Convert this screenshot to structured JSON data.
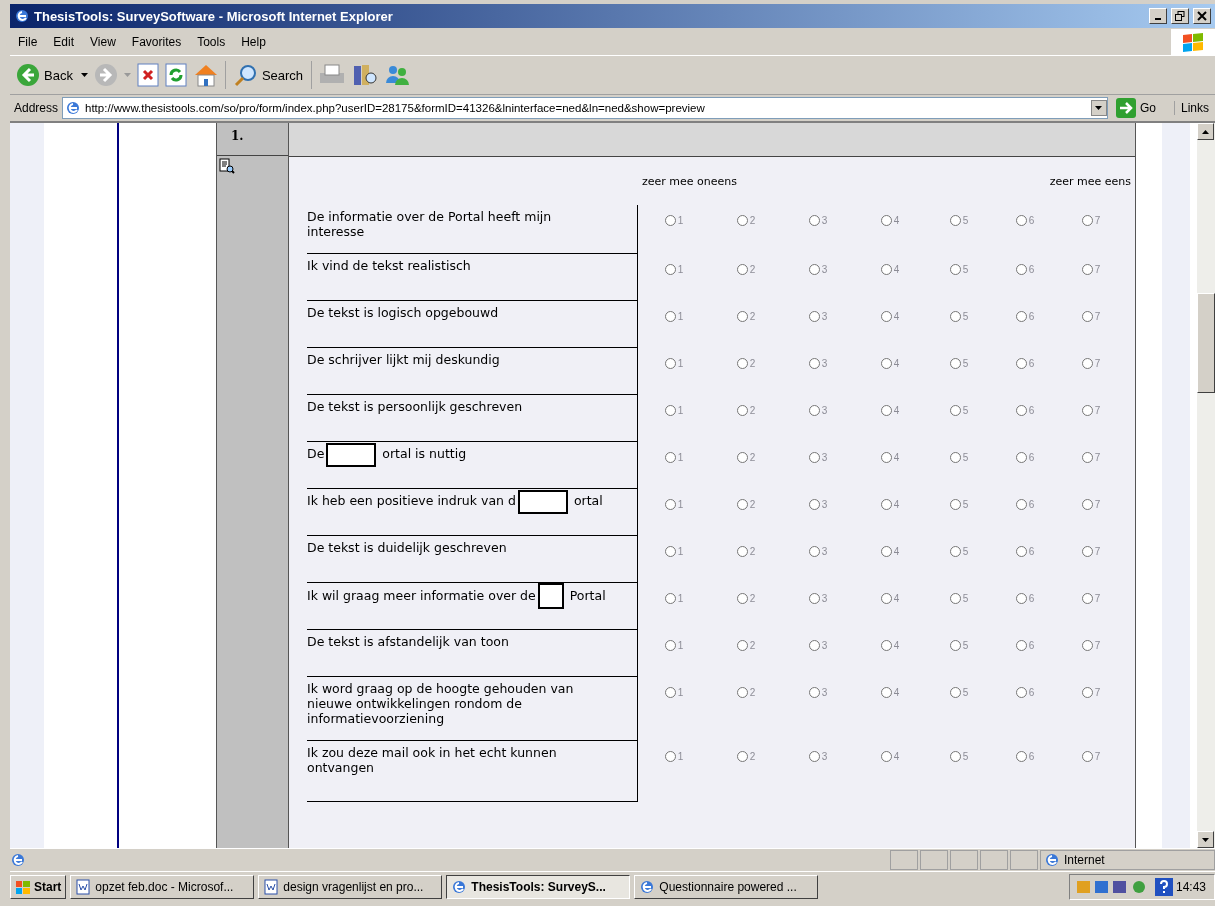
{
  "window": {
    "title": "ThesisTools: SurveySoftware - Microsoft Internet Explorer"
  },
  "menu": [
    "File",
    "Edit",
    "View",
    "Favorites",
    "Tools",
    "Help"
  ],
  "toolbar": {
    "back": "Back",
    "search": "Search"
  },
  "address": {
    "label": "Address",
    "url": "http://www.thesistools.com/so/pro/form/index.php?userID=28175&formID=41326&lninterface=ned&ln=ned&show=preview",
    "go": "Go",
    "links": "Links"
  },
  "question": {
    "number": "1.",
    "scale_low": "zeer mee oneens",
    "scale_high": "zeer mee eens",
    "rows": [
      {
        "parts": [
          "De informatie over de Portal heeft mijn interesse"
        ],
        "choices": [
          {
            "label": "1",
            "selected": false
          },
          {
            "label": "2",
            "selected": false
          },
          {
            "label": "3",
            "selected": false
          },
          {
            "label": "4",
            "selected": false
          },
          {
            "label": "5",
            "selected": false
          },
          {
            "label": "6",
            "selected": false
          },
          {
            "label": "7",
            "selected": false
          }
        ]
      },
      {
        "parts": [
          "Ik vind de tekst realistisch"
        ],
        "choices": [
          {
            "label": "1",
            "selected": false
          },
          {
            "label": "2",
            "selected": false
          },
          {
            "label": "3",
            "selected": false
          },
          {
            "label": "4",
            "selected": false
          },
          {
            "label": "5",
            "selected": false
          },
          {
            "label": "6",
            "selected": false
          },
          {
            "label": "7",
            "selected": false
          }
        ]
      },
      {
        "parts": [
          "De tekst is logisch opgebouwd"
        ],
        "choices": [
          {
            "label": "1",
            "selected": false
          },
          {
            "label": "2",
            "selected": false
          },
          {
            "label": "3",
            "selected": false
          },
          {
            "label": "4",
            "selected": false
          },
          {
            "label": "5",
            "selected": false
          },
          {
            "label": "6",
            "selected": false
          },
          {
            "label": "7",
            "selected": false
          }
        ]
      },
      {
        "parts": [
          "De schrijver lijkt mij deskundig"
        ],
        "choices": [
          {
            "label": "1",
            "selected": false
          },
          {
            "label": "2",
            "selected": false
          },
          {
            "label": "3",
            "selected": false
          },
          {
            "label": "4",
            "selected": false
          },
          {
            "label": "5",
            "selected": false
          },
          {
            "label": "6",
            "selected": false
          },
          {
            "label": "7",
            "selected": false
          }
        ]
      },
      {
        "parts": [
          "De tekst is persoonlijk geschreven"
        ],
        "choices": [
          {
            "label": "1",
            "selected": false
          },
          {
            "label": "2",
            "selected": false
          },
          {
            "label": "3",
            "selected": false
          },
          {
            "label": "4",
            "selected": false
          },
          {
            "label": "5",
            "selected": false
          },
          {
            "label": "6",
            "selected": false
          },
          {
            "label": "7",
            "selected": false
          }
        ]
      },
      {
        "parts": [
          "De",
          "ortal is nuttig"
        ],
        "choices": [
          {
            "label": "1",
            "selected": false
          },
          {
            "label": "2",
            "selected": false
          },
          {
            "label": "3",
            "selected": false
          },
          {
            "label": "4",
            "selected": false
          },
          {
            "label": "5",
            "selected": false
          },
          {
            "label": "6",
            "selected": false
          },
          {
            "label": "7",
            "selected": false
          }
        ]
      },
      {
        "parts": [
          "Ik heb een positieve indruk van d",
          "ortal"
        ],
        "choices": [
          {
            "label": "1",
            "selected": false
          },
          {
            "label": "2",
            "selected": false
          },
          {
            "label": "3",
            "selected": false
          },
          {
            "label": "4",
            "selected": false
          },
          {
            "label": "5",
            "selected": false
          },
          {
            "label": "6",
            "selected": false
          },
          {
            "label": "7",
            "selected": false
          }
        ]
      },
      {
        "parts": [
          "De tekst is duidelijk geschreven"
        ],
        "choices": [
          {
            "label": "1",
            "selected": false
          },
          {
            "label": "2",
            "selected": false
          },
          {
            "label": "3",
            "selected": false
          },
          {
            "label": "4",
            "selected": false
          },
          {
            "label": "5",
            "selected": false
          },
          {
            "label": "6",
            "selected": false
          },
          {
            "label": "7",
            "selected": false
          }
        ]
      },
      {
        "parts": [
          "Ik wil graag meer informatie over de",
          "Portal"
        ],
        "choices": [
          {
            "label": "1",
            "selected": false
          },
          {
            "label": "2",
            "selected": false
          },
          {
            "label": "3",
            "selected": false
          },
          {
            "label": "4",
            "selected": false
          },
          {
            "label": "5",
            "selected": false
          },
          {
            "label": "6",
            "selected": false
          },
          {
            "label": "7",
            "selected": false
          }
        ]
      },
      {
        "parts": [
          "De tekst is afstandelijk van toon"
        ],
        "choices": [
          {
            "label": "1",
            "selected": false
          },
          {
            "label": "2",
            "selected": false
          },
          {
            "label": "3",
            "selected": false
          },
          {
            "label": "4",
            "selected": false
          },
          {
            "label": "5",
            "selected": false
          },
          {
            "label": "6",
            "selected": false
          },
          {
            "label": "7",
            "selected": false
          }
        ]
      },
      {
        "parts": [
          "Ik word graag op de hoogte gehouden van nieuwe ontwikkelingen rondom de informatievoorziening"
        ],
        "choices": [
          {
            "label": "1",
            "selected": false
          },
          {
            "label": "2",
            "selected": false
          },
          {
            "label": "3",
            "selected": false
          },
          {
            "label": "4",
            "selected": false
          },
          {
            "label": "5",
            "selected": false
          },
          {
            "label": "6",
            "selected": false
          },
          {
            "label": "7",
            "selected": false
          }
        ]
      },
      {
        "parts": [
          "Ik zou deze mail ook in het echt kunnen ontvangen"
        ],
        "choices": [
          {
            "label": "1",
            "selected": false
          },
          {
            "label": "2",
            "selected": false
          },
          {
            "label": "3",
            "selected": false
          },
          {
            "label": "4",
            "selected": false
          },
          {
            "label": "5",
            "selected": false
          },
          {
            "label": "6",
            "selected": false
          },
          {
            "label": "7",
            "selected": false
          }
        ]
      }
    ]
  },
  "status_bar": {
    "zone": "Internet"
  },
  "taskbar": {
    "start": "Start",
    "tasks": [
      {
        "label": "opzet feb.doc - Microsof...",
        "kind": "word",
        "selected": false
      },
      {
        "label": "design vragenlijst en pro...",
        "kind": "word",
        "selected": false
      },
      {
        "label": "ThesisTools: SurveyS...",
        "kind": "ie",
        "selected": true
      },
      {
        "label": "Questionnaire powered ...",
        "kind": "ie",
        "selected": false
      }
    ],
    "clock": "14:43"
  }
}
